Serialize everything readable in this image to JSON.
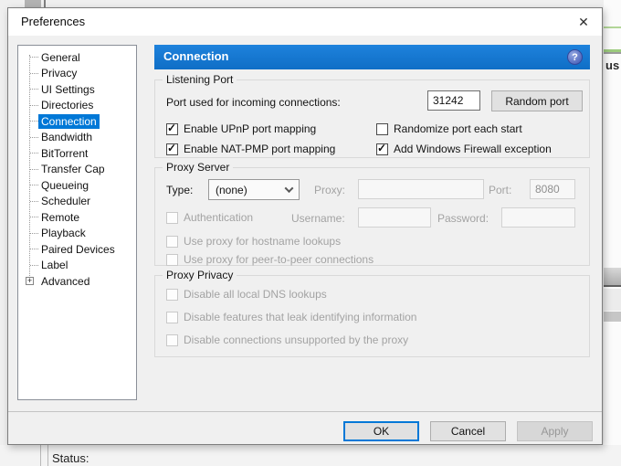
{
  "window": {
    "title": "Preferences"
  },
  "icons": {
    "close": "✕",
    "check": "✓",
    "plus": "+",
    "help": "?"
  },
  "sidebar": {
    "items": [
      {
        "label": "General",
        "selected": false
      },
      {
        "label": "Privacy",
        "selected": false
      },
      {
        "label": "UI Settings",
        "selected": false
      },
      {
        "label": "Directories",
        "selected": false
      },
      {
        "label": "Connection",
        "selected": true
      },
      {
        "label": "Bandwidth",
        "selected": false
      },
      {
        "label": "BitTorrent",
        "selected": false
      },
      {
        "label": "Transfer Cap",
        "selected": false
      },
      {
        "label": "Queueing",
        "selected": false
      },
      {
        "label": "Scheduler",
        "selected": false
      },
      {
        "label": "Remote",
        "selected": false
      },
      {
        "label": "Playback",
        "selected": false
      },
      {
        "label": "Paired Devices",
        "selected": false
      },
      {
        "label": "Label",
        "selected": false
      },
      {
        "label": "Advanced",
        "selected": false,
        "expandable": true
      }
    ]
  },
  "header": {
    "title": "Connection",
    "help_icon": "?"
  },
  "listening_port": {
    "title": "Listening Port",
    "port_label": "Port used for incoming connections:",
    "port_value": "31242",
    "random_port_button": "Random port",
    "checkboxes": [
      {
        "label": "Enable UPnP port mapping",
        "checked": true,
        "disabled": false
      },
      {
        "label": "Randomize port each start",
        "checked": false,
        "disabled": false
      },
      {
        "label": "Enable NAT-PMP port mapping",
        "checked": true,
        "disabled": false
      },
      {
        "label": "Add Windows Firewall exception",
        "checked": true,
        "disabled": false
      }
    ]
  },
  "proxy_server": {
    "title": "Proxy Server",
    "type_label": "Type:",
    "type_value": "(none)",
    "proxy_label": "Proxy:",
    "proxy_value": "",
    "port_label": "Port:",
    "port_value": "8080",
    "username_label": "Username:",
    "username_value": "",
    "password_label": "Password:",
    "password_value": "",
    "auth_checkbox": {
      "label": "Authentication",
      "checked": false,
      "disabled": true
    },
    "hostname_checkbox": {
      "label": "Use proxy for hostname lookups",
      "checked": false,
      "disabled": true
    },
    "p2p_checkbox": {
      "label": "Use proxy for peer-to-peer connections",
      "checked": false,
      "disabled": true
    }
  },
  "proxy_privacy": {
    "title": "Proxy Privacy",
    "checkboxes": [
      {
        "label": "Disable all local DNS lookups",
        "checked": false,
        "disabled": true
      },
      {
        "label": "Disable features that leak identifying information",
        "checked": false,
        "disabled": true
      },
      {
        "label": "Disable connections unsupported by the proxy",
        "checked": false,
        "disabled": true
      }
    ]
  },
  "footer": {
    "ok": "OK",
    "cancel": "Cancel",
    "apply": "Apply",
    "apply_disabled": true
  },
  "background": {
    "status_label": "Status:",
    "column_fragment": "us"
  },
  "colors": {
    "accent": "#0078d7",
    "header_blue_top": "#1e82dc",
    "header_blue_bottom": "#0f6ec6",
    "green_line": "#9ccb7d"
  }
}
